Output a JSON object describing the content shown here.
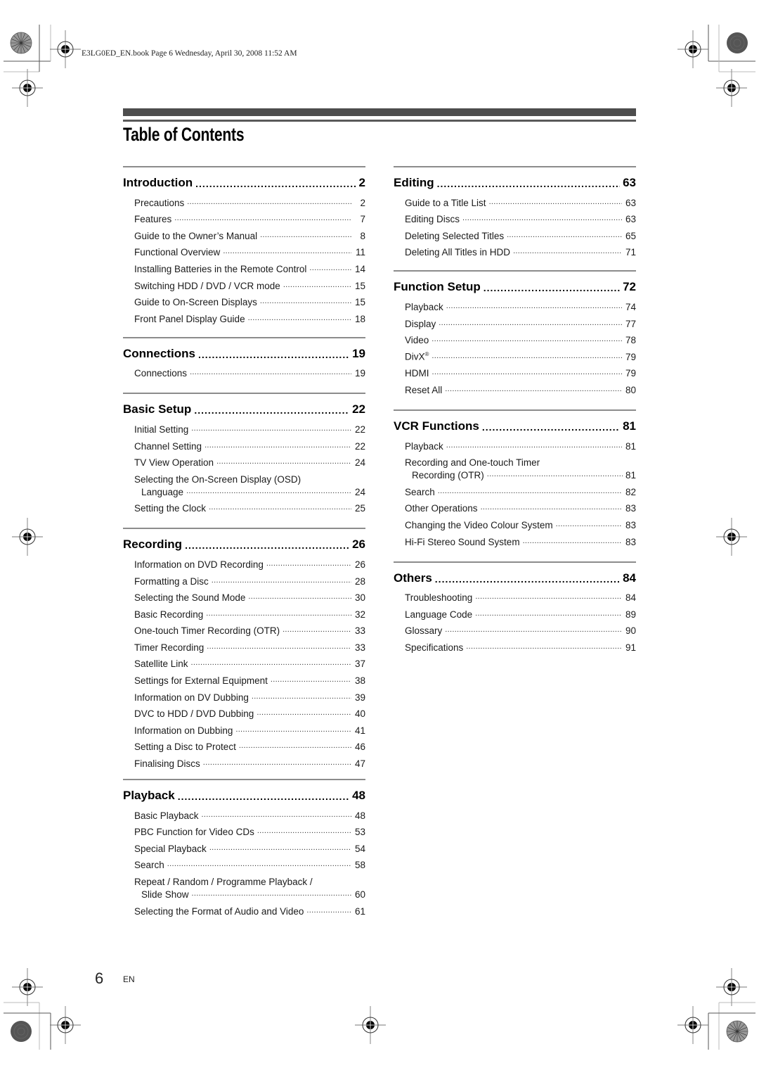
{
  "file_header": "E3LG0ED_EN.book  Page 6  Wednesday, April 30, 2008  11:52 AM",
  "page_title": "Table of Contents",
  "footer": {
    "page_number": "6",
    "language": "EN"
  },
  "columns": {
    "left": [
      {
        "title": "Introduction",
        "page": "2",
        "entries": [
          {
            "title": "Precautions",
            "page": "2"
          },
          {
            "title": "Features",
            "page": "7"
          },
          {
            "title": "Guide to the Owner’s Manual",
            "page": "8"
          },
          {
            "title": "Functional Overview",
            "page": "11"
          },
          {
            "title": "Installing Batteries in the Remote Control",
            "page": "14"
          },
          {
            "title": "Switching HDD / DVD / VCR mode",
            "page": "15"
          },
          {
            "title": "Guide to On-Screen Displays",
            "page": "15"
          },
          {
            "title": "Front Panel Display Guide",
            "page": "18"
          }
        ]
      },
      {
        "title": "Connections",
        "page": "19",
        "entries": [
          {
            "title": "Connections",
            "page": "19"
          }
        ]
      },
      {
        "title": "Basic Setup",
        "page": "22",
        "entries": [
          {
            "title": "Initial Setting",
            "page": "22"
          },
          {
            "title": "Channel Setting",
            "page": "22"
          },
          {
            "title": "TV View Operation",
            "page": "24"
          },
          {
            "title": "Selecting the On-Screen Display (OSD)",
            "title_cont": "Language",
            "page": "24"
          },
          {
            "title": "Setting the Clock",
            "page": "25"
          }
        ]
      },
      {
        "title": "Recording",
        "page": "26",
        "entries": [
          {
            "title": "Information on DVD Recording",
            "page": "26"
          },
          {
            "title": "Formatting a Disc",
            "page": "28"
          },
          {
            "title": "Selecting the Sound Mode",
            "page": "30"
          },
          {
            "title": "Basic Recording",
            "page": "32"
          },
          {
            "title": "One-touch Timer Recording (OTR)",
            "page": "33"
          },
          {
            "title": "Timer Recording",
            "page": "33"
          },
          {
            "title": "Satellite Link",
            "page": "37"
          },
          {
            "title": "Settings for External Equipment",
            "page": "38"
          },
          {
            "title": "Information on DV Dubbing",
            "page": "39"
          },
          {
            "title": "DVC to HDD / DVD Dubbing",
            "page": "40"
          },
          {
            "title": "Information on Dubbing",
            "page": "41"
          },
          {
            "title": "Setting a Disc to Protect",
            "page": "46"
          },
          {
            "title": "Finalising Discs",
            "page": "47"
          }
        ]
      },
      {
        "title": "Playback",
        "page": "48",
        "entries": [
          {
            "title": "Basic Playback",
            "page": "48"
          },
          {
            "title": "PBC Function for Video CDs",
            "page": "53"
          },
          {
            "title": "Special Playback",
            "page": "54"
          },
          {
            "title": "Search",
            "page": "58"
          },
          {
            "title": "Repeat / Random / Programme Playback /",
            "title_cont": "Slide Show",
            "page": "60"
          },
          {
            "title": "Selecting the Format of Audio and Video",
            "page": "61"
          }
        ]
      }
    ],
    "right": [
      {
        "title": "Editing",
        "page": "63",
        "entries": [
          {
            "title": "Guide to a Title List",
            "page": "63"
          },
          {
            "title": "Editing Discs",
            "page": "63"
          },
          {
            "title": "Deleting Selected Titles",
            "page": "65"
          },
          {
            "title": "Deleting All Titles in HDD",
            "page": "71"
          }
        ]
      },
      {
        "title": "Function Setup",
        "page": "72",
        "entries": [
          {
            "title": "Playback",
            "page": "74"
          },
          {
            "title": "Display",
            "page": "77"
          },
          {
            "title": "Video",
            "page": "78"
          },
          {
            "title": "DivX",
            "sup": "®",
            "page": "79"
          },
          {
            "title": "HDMI",
            "page": "79"
          },
          {
            "title": "Reset All",
            "page": "80"
          }
        ]
      },
      {
        "title": "VCR Functions",
        "page": "81",
        "entries": [
          {
            "title": "Playback",
            "page": "81"
          },
          {
            "title": "Recording and One-touch Timer",
            "title_cont": "Recording (OTR)",
            "page": "81"
          },
          {
            "title": "Search",
            "page": "82"
          },
          {
            "title": "Other Operations",
            "page": "83"
          },
          {
            "title": "Changing the Video Colour System",
            "page": "83"
          },
          {
            "title": "Hi-Fi Stereo Sound System",
            "page": "83"
          }
        ]
      },
      {
        "title": "Others",
        "page": "84",
        "entries": [
          {
            "title": "Troubleshooting",
            "page": "84"
          },
          {
            "title": "Language Code",
            "page": "89"
          },
          {
            "title": "Glossary",
            "page": "90"
          },
          {
            "title": "Specifications",
            "page": "91"
          }
        ]
      }
    ]
  }
}
